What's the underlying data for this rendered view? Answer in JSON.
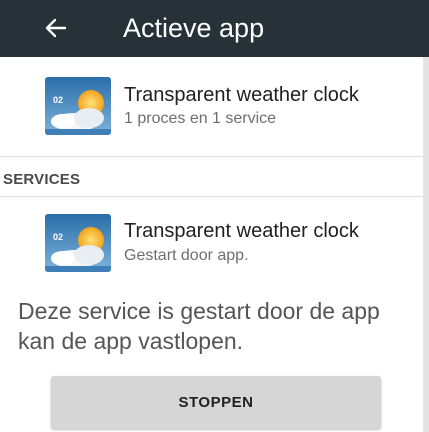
{
  "app_bar": {
    "back_icon": "arrow-left-icon",
    "title": "Actieve app",
    "background_color": "#263238"
  },
  "app_entry": {
    "icon": "weather-clock-icon",
    "name": "Transparent weather clock",
    "subtitle": "1 proces en 1 service",
    "icon_time_text": "02"
  },
  "services_section": {
    "header": "SERVICES"
  },
  "service_entry": {
    "icon": "weather-clock-icon",
    "name": "Transparent weather clock",
    "subtitle": "Gestart door app.",
    "icon_time_text": "02"
  },
  "description": {
    "text": "Deze service is gestart door de app\nkan de app vastlopen."
  },
  "actions": {
    "stop_label": "STOPPEN"
  }
}
